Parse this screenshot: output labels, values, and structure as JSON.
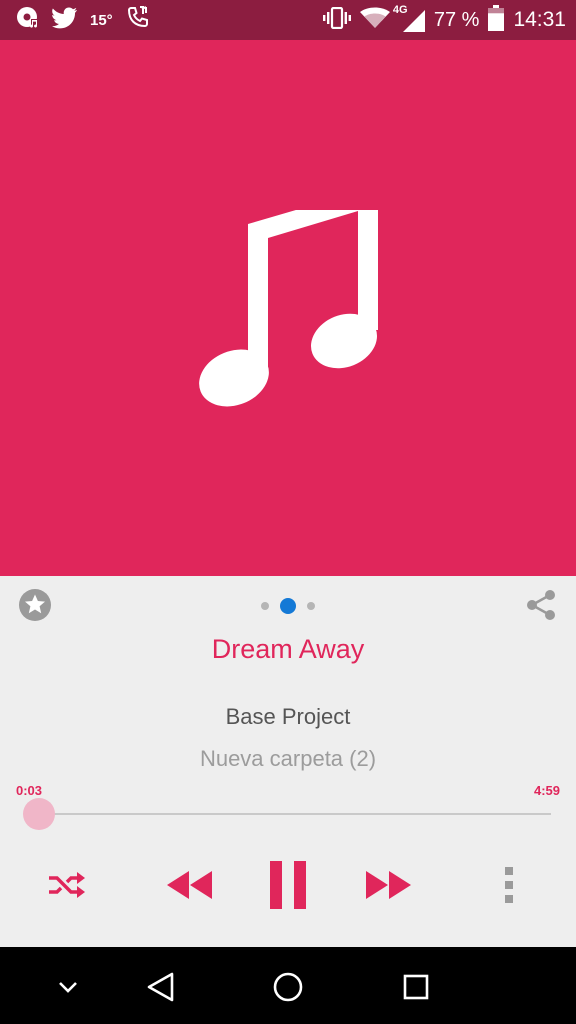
{
  "status_bar": {
    "temperature": "15°",
    "battery_percent": "77 %",
    "network_type": "4G",
    "time": "14:31",
    "battery_level": 0.77,
    "icons": [
      "music-notification-icon",
      "twitter-icon",
      "phone-call-icon",
      "vibrate-icon",
      "wifi-icon",
      "signal-icon",
      "battery-icon"
    ]
  },
  "album_art": {
    "icon": "music-note-icon",
    "background_color": "#e0265b"
  },
  "pager": {
    "page_count": 3,
    "active_index": 1
  },
  "track": {
    "title": "Dream Away",
    "artist": "Base Project",
    "folder": "Nueva carpeta (2)"
  },
  "progress": {
    "current_time": "0:03",
    "total_time": "4:59",
    "fraction": 0.01
  },
  "controls": [
    "shuffle-icon",
    "rewind-icon",
    "pause-icon",
    "fast-forward-icon",
    "more-vert-icon"
  ],
  "actions": [
    "favorite-star-icon",
    "share-icon"
  ],
  "nav_bar": [
    "collapse-keyboard-icon",
    "back-icon",
    "home-icon",
    "recents-icon"
  ],
  "colors": {
    "accent": "#e0265b",
    "status_bar": "#8c1d40",
    "active_dot": "#1479d6",
    "panel": "#eeeeee"
  }
}
